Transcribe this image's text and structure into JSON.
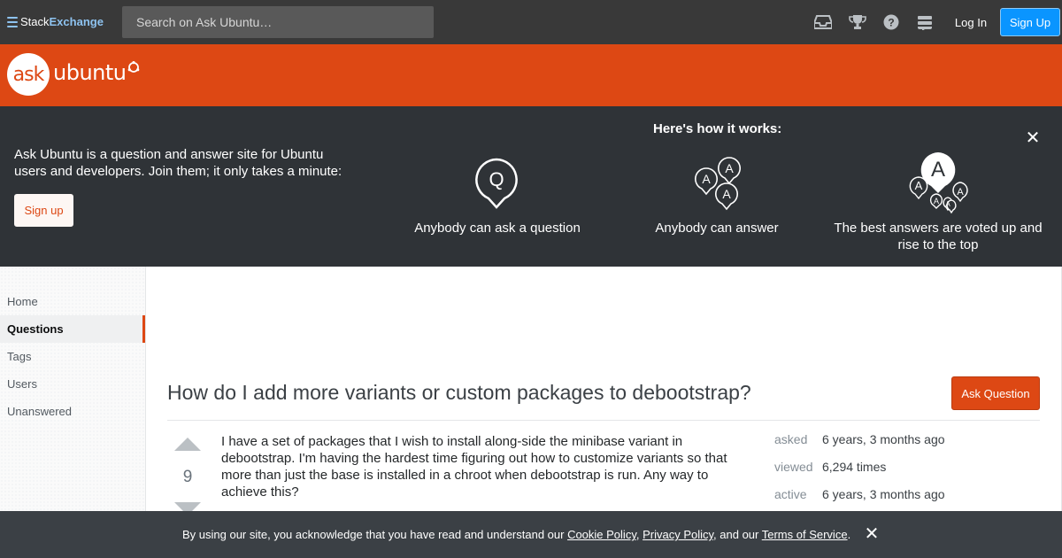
{
  "topbar": {
    "brand_part1": "Stack",
    "brand_part2": "Exchange",
    "search_placeholder": "Search on Ask Ubuntu…",
    "icons": [
      "inbox-icon",
      "trophy-icon",
      "help-icon",
      "site-switcher-icon"
    ],
    "login_label": "Log In",
    "signup_label": "Sign Up"
  },
  "site": {
    "logo_mark": "ask",
    "logo_word": "ubuntu",
    "brand_color": "#dd4814"
  },
  "hero": {
    "description": "Ask Ubuntu is a question and answer site for Ubuntu users and developers. Join them; it only takes a minute:",
    "signup_label": "Sign up",
    "how_title": "Here's how it works:",
    "steps": [
      {
        "label": "Anybody can ask a question",
        "icon": "question-bubble-icon"
      },
      {
        "label": "Anybody can answer",
        "icon": "answer-bubbles-icon"
      },
      {
        "label": "The best answers are voted up and rise to the top",
        "icon": "voted-answers-icon"
      }
    ]
  },
  "nav": {
    "items": [
      "Home",
      "Questions",
      "Tags",
      "Users",
      "Unanswered"
    ],
    "active": "Questions"
  },
  "question": {
    "title": "How do I add more variants or custom packages to debootstrap?",
    "ask_label": "Ask Question",
    "votes": "9",
    "body": "I have a set of packages that I wish to install along-side the minibase variant in debootstrap. I'm having the hardest time figuring out how to customize variants so that more than just the base is installed in a chroot when debootstrap is run. Any way to achieve this?",
    "meta": [
      {
        "label": "asked",
        "value": "6 years, 3 months ago"
      },
      {
        "label": "viewed",
        "value": "6,294 times"
      },
      {
        "label": "active",
        "value": "6 years, 3 months ago"
      }
    ]
  },
  "cookie": {
    "prefix": "By using our site, you acknowledge that you have read and understand our ",
    "cookie_policy": "Cookie Policy",
    "sep1": ", ",
    "privacy_policy": "Privacy Policy",
    "sep2": ", and our ",
    "terms": "Terms of Service",
    "suffix": "."
  }
}
